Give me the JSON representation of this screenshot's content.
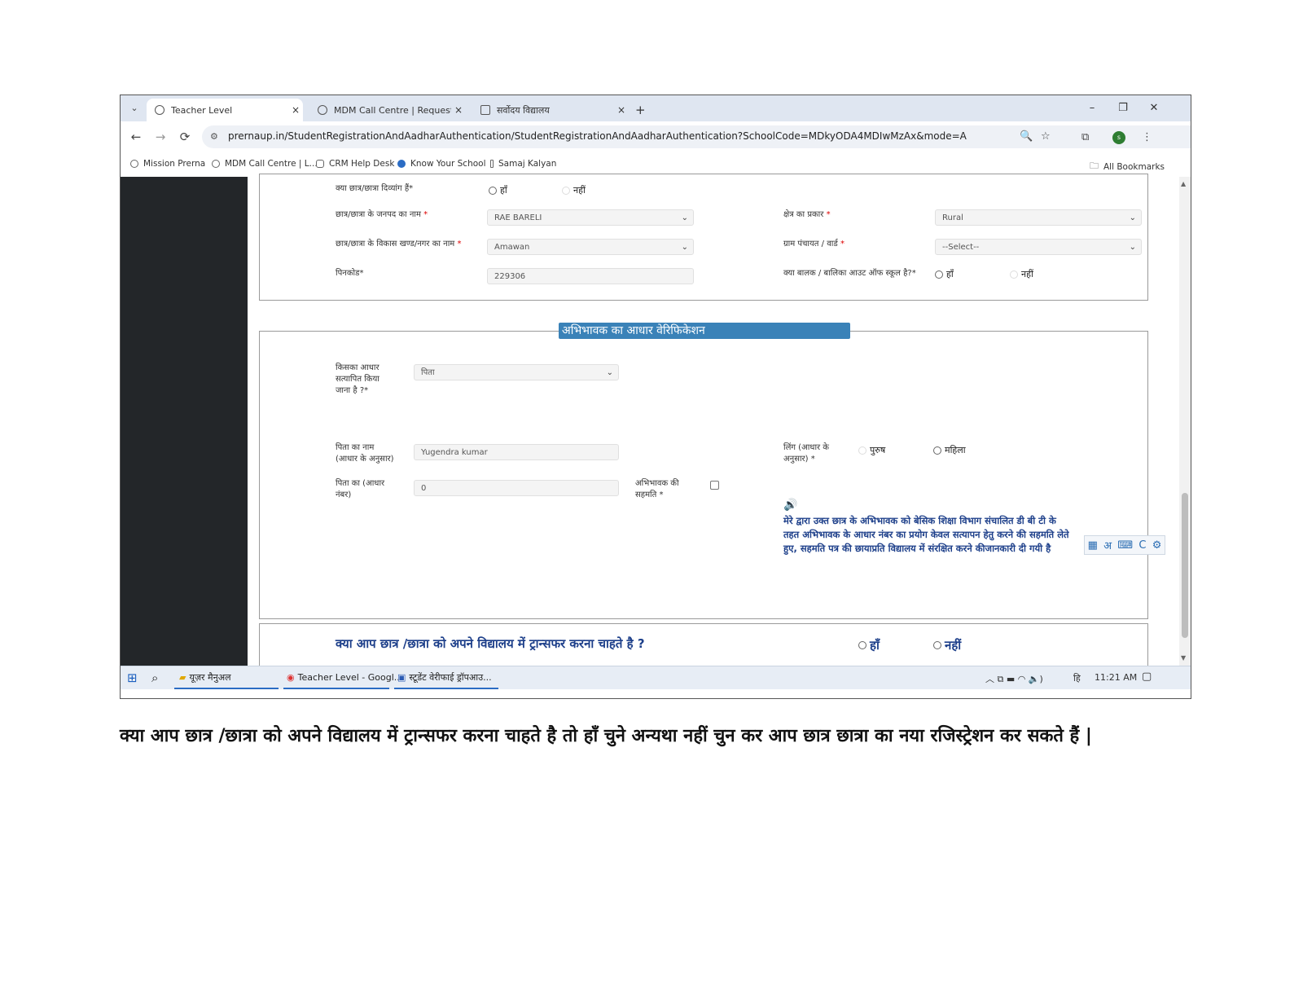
{
  "browser": {
    "tabs": [
      {
        "label": "Teacher Level"
      },
      {
        "label": "MDM Call Centre | Request"
      },
      {
        "label": "सर्वोदय विद्यालय"
      }
    ],
    "new_tab_label": "+",
    "tab_close": "×",
    "dropdown_label": "⌄",
    "window": {
      "minimize": "–",
      "restore": "❐",
      "close": "✕"
    },
    "nav": {
      "back": "←",
      "forward": "→",
      "reload": "⟳"
    },
    "url": "prernaup.in/StudentRegistrationAndAadharAuthentication/StudentRegistrationAndAadharAuthentication?SchoolCode=MDkyODA4MDIwMzAx&mode=A",
    "avatar_text": "s",
    "bookmarks": [
      "Mission Prerna",
      "MDM Call Centre | L...",
      "CRM Help Desk",
      "Know Your School",
      "Samaj Kalyan"
    ],
    "all_bookmarks": "All Bookmarks"
  },
  "form": {
    "disabled_q": {
      "label": "क्या छात्र/छात्रा दिव्यांग हैं*",
      "yes": "हाँ",
      "no": "नहीं"
    },
    "district": {
      "label": "छात्र/छात्रा के जनपद का नाम",
      "value": "RAE BARELI"
    },
    "area_type": {
      "label": "क्षेत्र का प्रकार",
      "value": "Rural"
    },
    "block": {
      "label": "छात्र/छात्रा के विकास खण्ड/नगर का नाम",
      "value": "Amawan"
    },
    "panchayat": {
      "label": "ग्राम पंचायत / वार्ड",
      "value": "--Select--"
    },
    "pincode": {
      "label": "पिनकोड*",
      "value": "229306"
    },
    "out_of_school": {
      "label": "क्या बालक / बालिका आउट ऑफ स्कूल है?*",
      "yes": "हाँ",
      "no": "नहीं"
    },
    "required_mark": "*"
  },
  "guardian": {
    "legend": "अभिभावक का आधार वेरिफिकेशन",
    "whose_aadhaar": {
      "label_lines": [
        "किसका आधार",
        "सत्यापित किया",
        "जाना है ?*"
      ],
      "value": "पिता"
    },
    "father_name": {
      "label_lines": [
        "पिता का नाम",
        "(आधार के अनुसार)"
      ],
      "value": "Yugendra kumar"
    },
    "gender": {
      "label_lines": [
        "लिंग (आधार के",
        "अनुसार) *"
      ],
      "male": "पुरुष",
      "female": "महिला"
    },
    "father_aadhaar": {
      "label_lines": [
        "पिता का (आधार",
        "नंबर)"
      ],
      "value": "0"
    },
    "consent_label": {
      "label_lines": [
        "अभिभावक की",
        "सहमति *"
      ]
    },
    "consent_text": "मेरे द्वारा उक्त छात्र के अभिभावक को बेसिक शिक्षा विभाग संचालित डी बी टी के तहत अभिभावक के आधार नंबर का प्रयोग केवल सत्यापन हेतु करने की सहमति लेते हुए, सहमति पत्र की छायाप्रति विद्यालय में संरक्षित करने कीजानकारी दी गयी है",
    "speaker_icon": "🔊"
  },
  "ime": {
    "items": [
      "▦",
      "अ",
      "⌨",
      "C",
      "⚙"
    ]
  },
  "transfer": {
    "question": "क्या आप छात्र /छात्रा को अपने विद्यालय में ट्रान्सफर करना चाहते है ?",
    "yes": "हाँ",
    "no": "नहीं"
  },
  "taskbar": {
    "start": "⊞",
    "search": "⌕",
    "apps": [
      "यूज़र मैनुअल",
      "Teacher Level - Googl...",
      "स्टूडेंट वेरीफाई ड्रॉपआउ..."
    ],
    "tray_icons": "︿  ⧉  ▬  ◠  🔈)",
    "lang": "हि",
    "time": "11:21 AM",
    "notif": "▢"
  },
  "caption": "क्या आप छात्र /छात्रा को अपने विद्यालय में ट्रान्सफर करना चाहते है तो हाँ चुने अन्यथा नहीं चुन कर आप छात्र छात्रा का नया रजिस्ट्रेशन कर सकते हैं |"
}
